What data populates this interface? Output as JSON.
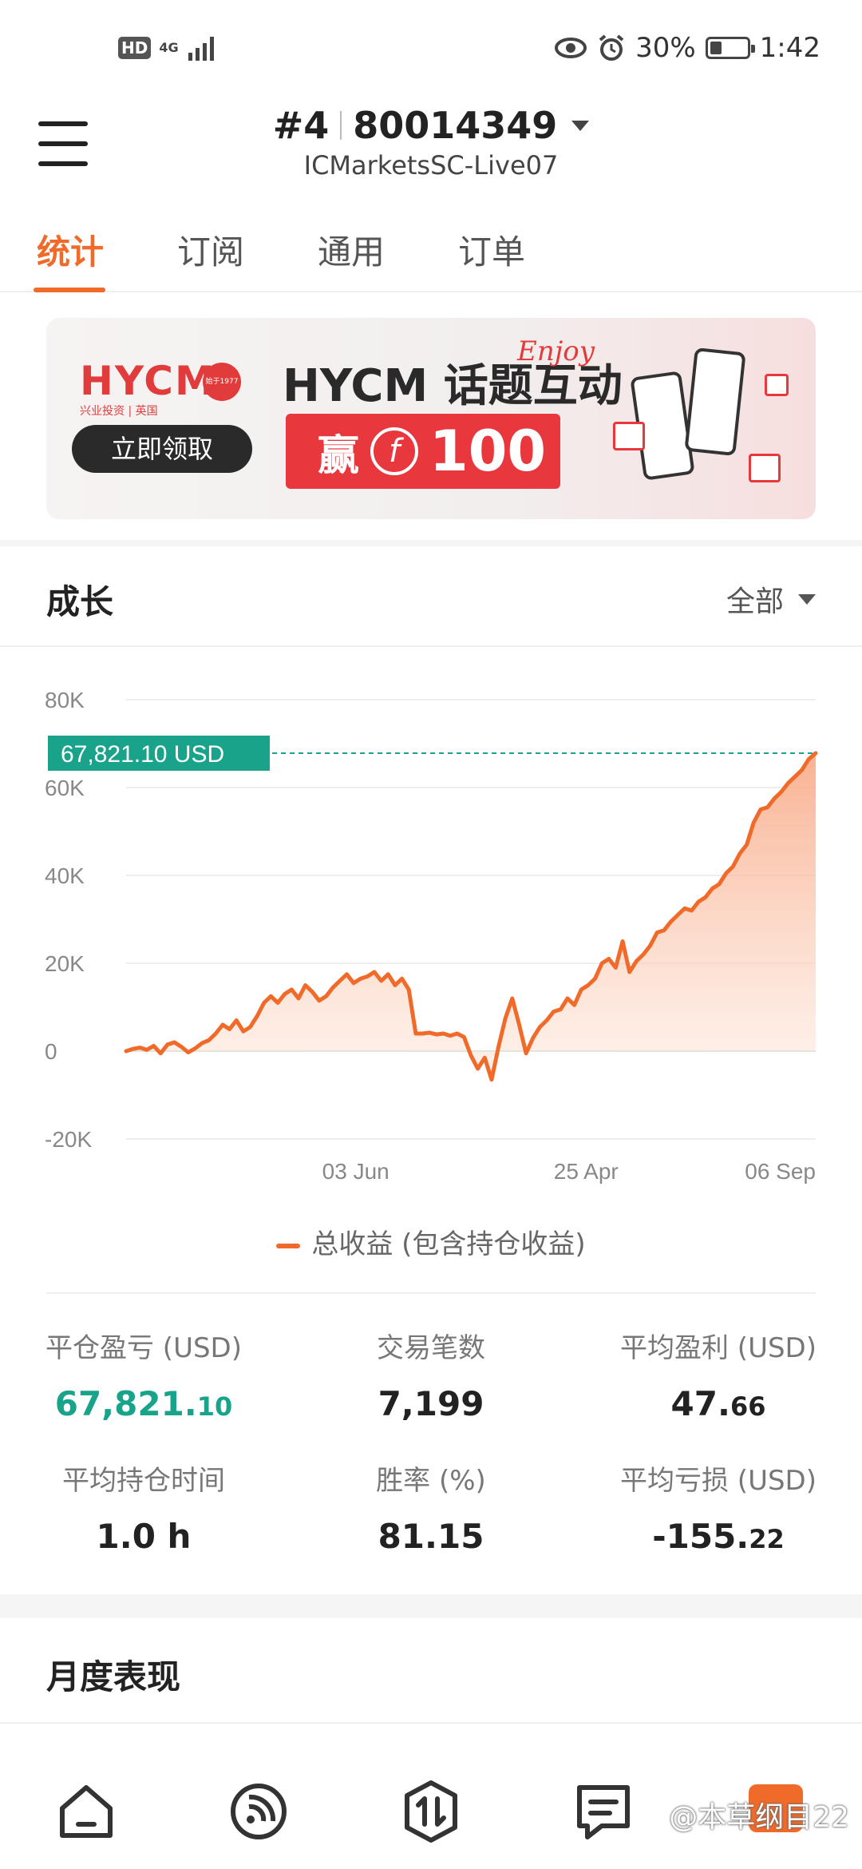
{
  "status_bar": {
    "hd": "HD",
    "network": "4G",
    "battery": "30%",
    "time": "1:42"
  },
  "header": {
    "account_index": "#4",
    "account_number": "80014349",
    "server": "ICMarketsSC-Live07"
  },
  "tabs": [
    {
      "label": "统计",
      "active": true
    },
    {
      "label": "订阅",
      "active": false
    },
    {
      "label": "通用",
      "active": false
    },
    {
      "label": "订单",
      "active": false
    }
  ],
  "banner": {
    "brand": "HYCM",
    "brand_sub": "兴业投资 | 英国",
    "since": "始于1977",
    "cta": "立即领取",
    "title": "HYCM 话题互动",
    "deco": "Enjoy",
    "win_label": "赢",
    "coin": "f",
    "amount": "100"
  },
  "growth": {
    "title": "成长",
    "range": "全部"
  },
  "chart_data": {
    "type": "area",
    "y_ticks": [
      "80K",
      "60K",
      "40K",
      "20K",
      "0",
      "-20K"
    ],
    "x_ticks": [
      "03 Jun",
      "25 Apr",
      "06 Sep"
    ],
    "ylim": [
      -20000,
      80000
    ],
    "current_label": "67,821.10 USD",
    "current_value": 67821.1,
    "line_color": "#f06b2a",
    "label_color": "#1aa38b",
    "series": [
      {
        "name": "总收益 (包含持仓收益)",
        "x": [
          0,
          1,
          2,
          3,
          4,
          5,
          6,
          7,
          8,
          9,
          10,
          11,
          12,
          13,
          14,
          15,
          16,
          17,
          18,
          19,
          20,
          21,
          22,
          23,
          24,
          25,
          26,
          27,
          28,
          29,
          30,
          31,
          32,
          33,
          34,
          35,
          36,
          37,
          38,
          39,
          40,
          41,
          42,
          43,
          44,
          45,
          46,
          47,
          48,
          49,
          50,
          51,
          52,
          53,
          54,
          55,
          56,
          57,
          58,
          59,
          60,
          61,
          62,
          63,
          64,
          65,
          66,
          67,
          68,
          69,
          70,
          71,
          72,
          73,
          74,
          75,
          76,
          77,
          78,
          79,
          80,
          81,
          82,
          83,
          84,
          85,
          86,
          87,
          88,
          89,
          90,
          91,
          92,
          93,
          94,
          95,
          96,
          97,
          98,
          99,
          100
        ],
        "values": [
          0,
          500,
          800,
          300,
          1200,
          -500,
          1500,
          2000,
          1000,
          -300,
          600,
          1800,
          2500,
          4000,
          6000,
          5000,
          7000,
          4500,
          5500,
          8000,
          11000,
          12500,
          11000,
          13000,
          14000,
          12000,
          15000,
          13500,
          11500,
          12500,
          14500,
          16000,
          17500,
          15500,
          16500,
          17000,
          18000,
          16000,
          17500,
          15000,
          16500,
          14000,
          4000,
          4000,
          4200,
          3800,
          4000,
          3500,
          4000,
          3200,
          -1000,
          -4000,
          -1500,
          -6500,
          1000,
          7500,
          12000,
          6000,
          -500,
          3000,
          5500,
          7000,
          9000,
          9500,
          12000,
          10500,
          14000,
          15000,
          16500,
          20000,
          21000,
          19000,
          25000,
          18000,
          20500,
          22000,
          24000,
          27000,
          27500,
          29500,
          31000,
          32500,
          32000,
          34000,
          35000,
          37000,
          38000,
          40500,
          42000,
          45000,
          47000,
          52000,
          55000,
          55500,
          57500,
          59000,
          61000,
          62500,
          64000,
          66500,
          67821.1
        ]
      }
    ],
    "legend": "总收益 (包含持仓收益)"
  },
  "stats": [
    {
      "label": "平仓盈亏 (USD)",
      "int": "67,821.",
      "dec": "10",
      "green": true
    },
    {
      "label": "交易笔数",
      "int": "7,199",
      "dec": "",
      "green": false
    },
    {
      "label": "平均盈利 (USD)",
      "int": "47.",
      "dec": "66",
      "green": false
    },
    {
      "label": "平均持仓时间",
      "int": "1.0 h",
      "dec": "",
      "green": false
    },
    {
      "label": "胜率 (%)",
      "int": "81.15",
      "dec": "",
      "green": false
    },
    {
      "label": "平均亏损 (USD)",
      "int": "-155.",
      "dec": "22",
      "green": false
    }
  ],
  "monthly": {
    "title": "月度表现"
  },
  "bottom_nav": {
    "items": [
      "home-icon",
      "feed-icon",
      "trade-icon",
      "messages-icon"
    ],
    "watermark": "@本草纲目22"
  }
}
